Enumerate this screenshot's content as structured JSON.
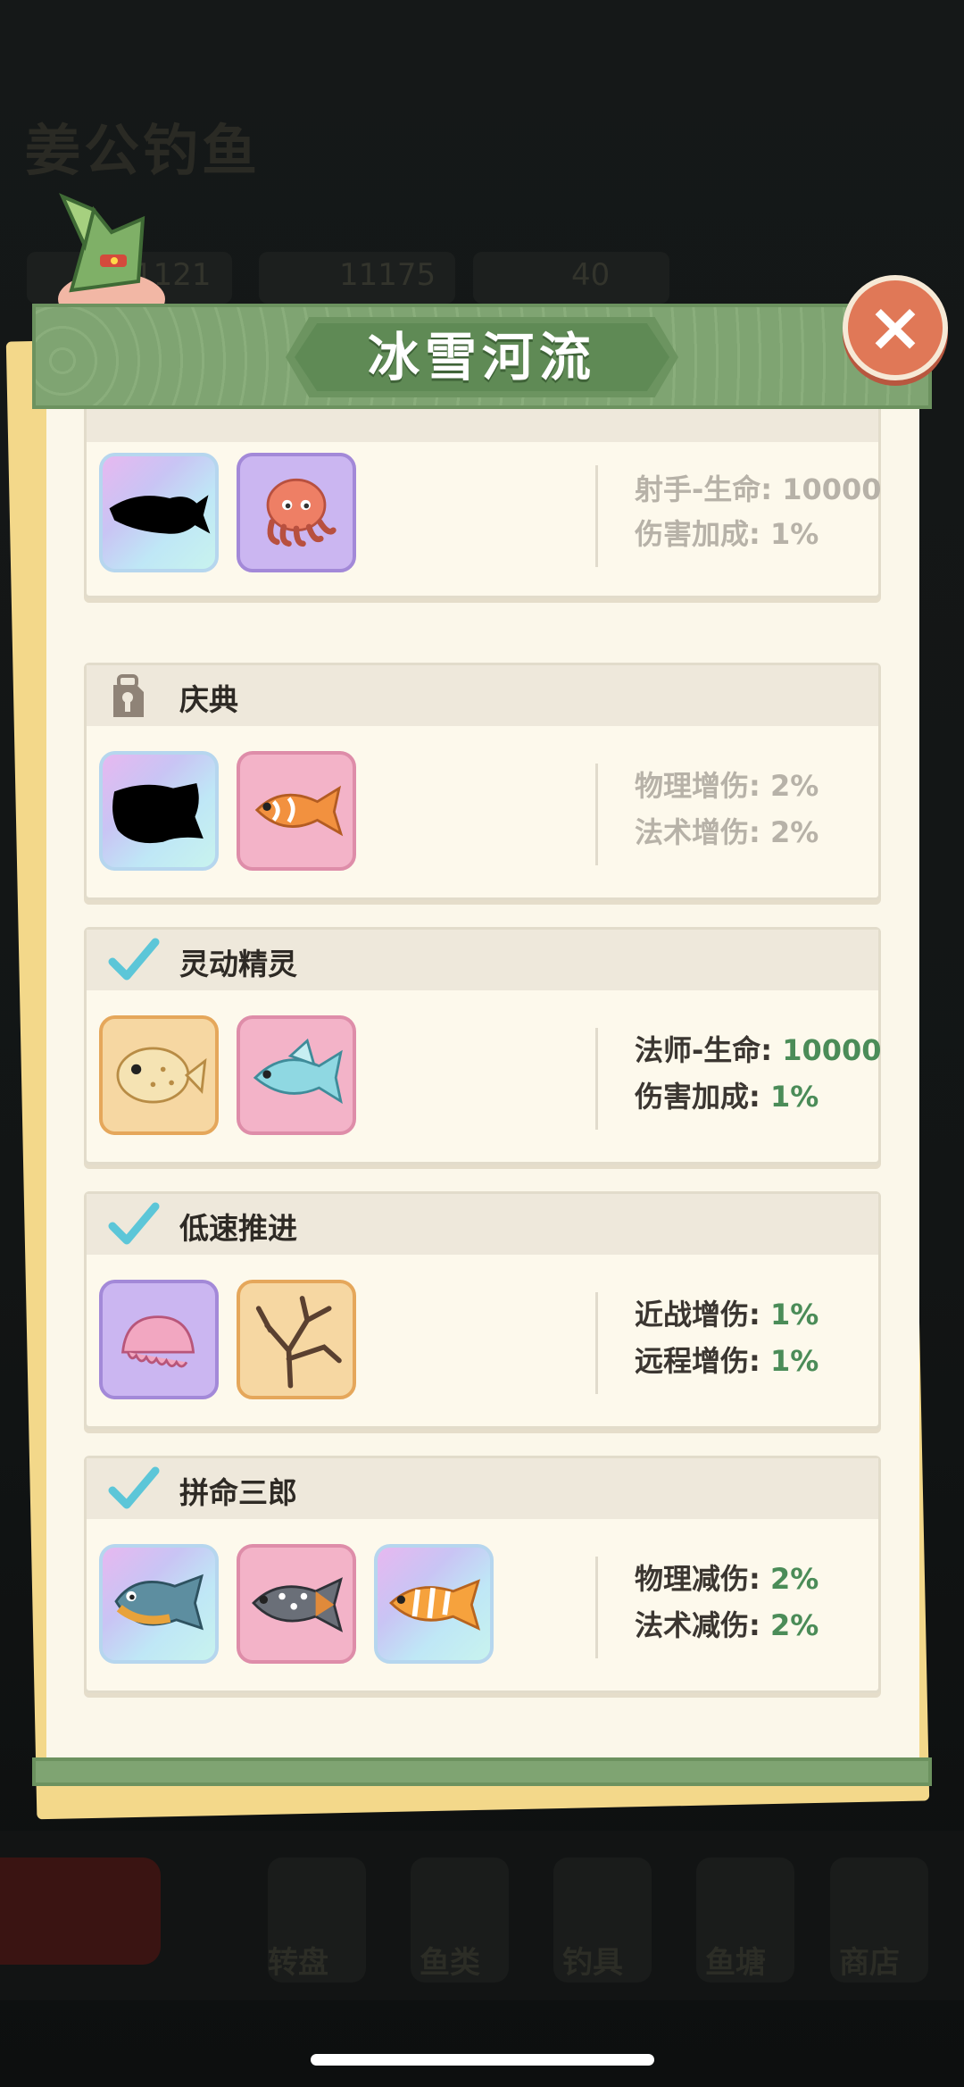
{
  "background": {
    "title": "姜公钓鱼",
    "stat_values": [
      "1121",
      "11175",
      "40"
    ],
    "nav_labels": [
      "转盘",
      "鱼类",
      "钓具",
      "鱼塘",
      "商店"
    ]
  },
  "panel": {
    "title": "冰雪河流",
    "close_symbol": "×"
  },
  "sets": [
    {
      "title": "",
      "unlocked": false,
      "stat1_label": "射手-生命: ",
      "stat1_value": "10000",
      "stat2_label": "伤害加成: ",
      "stat2_value": "1%",
      "icons": [
        "fish-silhouette-icon",
        "octopus-icon"
      ]
    },
    {
      "title": "庆典",
      "unlocked": false,
      "stat1_label": "物理增伤: ",
      "stat1_value": "2%",
      "stat2_label": "法术增伤: ",
      "stat2_value": "2%",
      "icons": [
        "fish-silhouette-icon",
        "orange-fish-icon"
      ]
    },
    {
      "title": "灵动精灵",
      "unlocked": true,
      "stat1_label": "法师-生命: ",
      "stat1_value": "10000",
      "stat2_label": "伤害加成: ",
      "stat2_value": "1%",
      "icons": [
        "pufferfish-icon",
        "blue-fish-icon"
      ]
    },
    {
      "title": "低速推进",
      "unlocked": true,
      "stat1_label": "近战增伤: ",
      "stat1_value": "1%",
      "stat2_label": "远程增伤: ",
      "stat2_value": "1%",
      "icons": [
        "jellyfish-icon",
        "coral-branch-icon"
      ]
    },
    {
      "title": "拼命三郎",
      "unlocked": true,
      "stat1_label": "物理减伤: ",
      "stat1_value": "2%",
      "stat2_label": "法术减伤: ",
      "stat2_value": "2%",
      "icons": [
        "piranha-icon",
        "spotted-fish-icon",
        "orange-striped-fish-icon"
      ]
    }
  ],
  "colors": {
    "header_green": "#7fa472",
    "close_orange": "#e07857",
    "value_green": "#4b8c58",
    "check_teal": "#5cc6d8",
    "locked_gray": "#b7b2a8"
  }
}
